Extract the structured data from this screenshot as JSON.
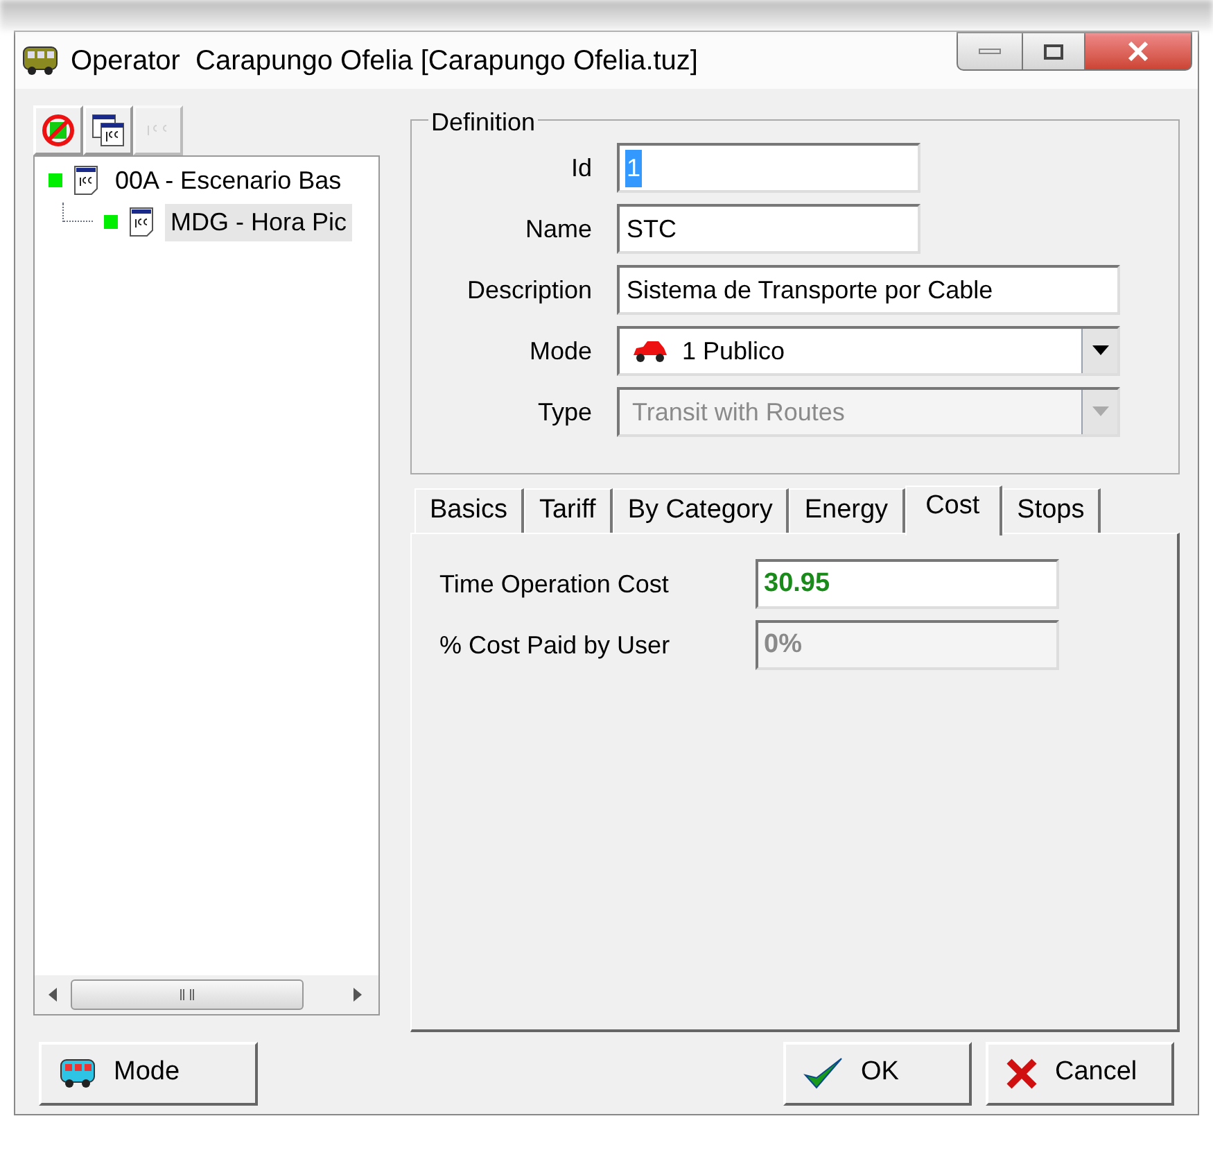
{
  "window": {
    "title": "Operator  Carapungo Ofelia [Carapungo Ofelia.tuz]"
  },
  "toolbar": [
    {
      "kind": "delete",
      "disabled": false
    },
    {
      "kind": "copy",
      "disabled": false
    },
    {
      "kind": "paste",
      "disabled": true
    }
  ],
  "tree": [
    {
      "code": "00A",
      "label": "- Escenario Bas",
      "selected": false,
      "children": [
        {
          "code": "MDG",
          "label": "- Hora Pic",
          "selected": true
        }
      ]
    }
  ],
  "definition": {
    "title": "Definition",
    "fields": [
      {
        "kind": "text",
        "label": "Id",
        "value": "1",
        "highlighted": true,
        "disabled": false,
        "wide": false
      },
      {
        "kind": "text",
        "label": "Name",
        "value": "STC",
        "highlighted": false,
        "disabled": false,
        "wide": false
      },
      {
        "kind": "text",
        "label": "Description",
        "value": "Sistema de Transporte por Cable",
        "highlighted": false,
        "disabled": false,
        "wide": true
      },
      {
        "kind": "combo",
        "label": "Mode",
        "value": "1 Publico",
        "highlighted": false,
        "disabled": false,
        "wide": true
      },
      {
        "kind": "combo",
        "label": "Type",
        "value": "Transit with Routes",
        "highlighted": false,
        "disabled": true,
        "wide": true
      }
    ]
  },
  "tabs": [
    {
      "label": "Basics",
      "selected": false
    },
    {
      "label": "Tariff",
      "selected": false
    },
    {
      "label": "By Category",
      "selected": false
    },
    {
      "label": "Energy",
      "selected": false
    },
    {
      "label": "Cost",
      "selected": true
    },
    {
      "label": "Stops",
      "selected": false
    }
  ],
  "cost": [
    {
      "label": "Time Operation Cost",
      "value": "30.95",
      "disabled": false
    },
    {
      "label": "% Cost Paid by User",
      "value": "0%",
      "disabled": true
    }
  ],
  "buttons": [
    {
      "kind": "mode",
      "label": "Mode"
    },
    {
      "kind": "ok",
      "label": "OK"
    },
    {
      "kind": "cancel",
      "label": "Cancel"
    }
  ]
}
